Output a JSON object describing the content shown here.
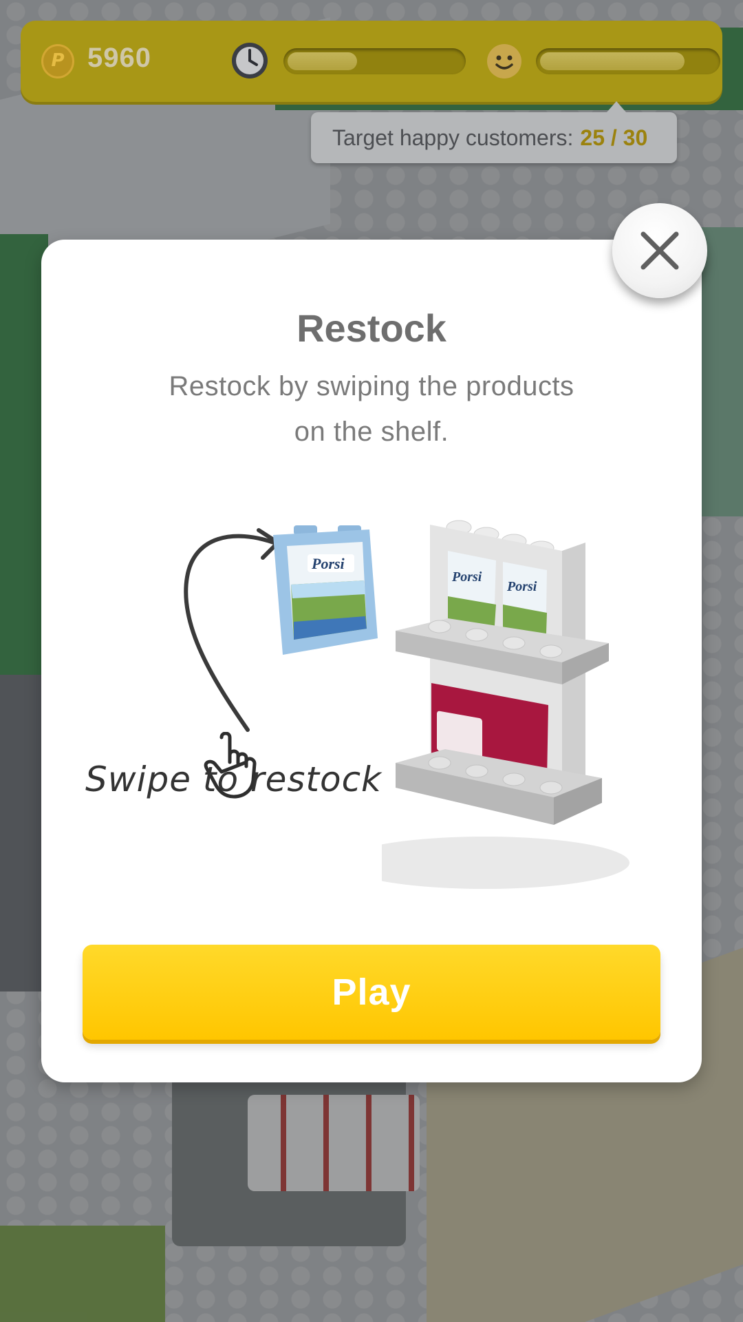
{
  "hud": {
    "coins": "5960",
    "coin_icon": "coin-icon",
    "clock_icon": "clock-icon",
    "time_progress": 0.4,
    "happiness_icon": "smiley-face-icon",
    "happiness_progress": 0.82
  },
  "tooltip": {
    "label": "Target happy customers:",
    "value": "25 / 30"
  },
  "dialog": {
    "title": "Restock",
    "description": "Restock by swiping the products on the  shelf.",
    "illustration_label": "Swipe to restock",
    "close_icon": "close-icon",
    "play_label": "Play"
  },
  "colors": {
    "accent_yellow": "#ffcc00",
    "hud_yellow": "#a89716",
    "target_value": "#9b820e",
    "title_gray": "#6e6e6e"
  }
}
